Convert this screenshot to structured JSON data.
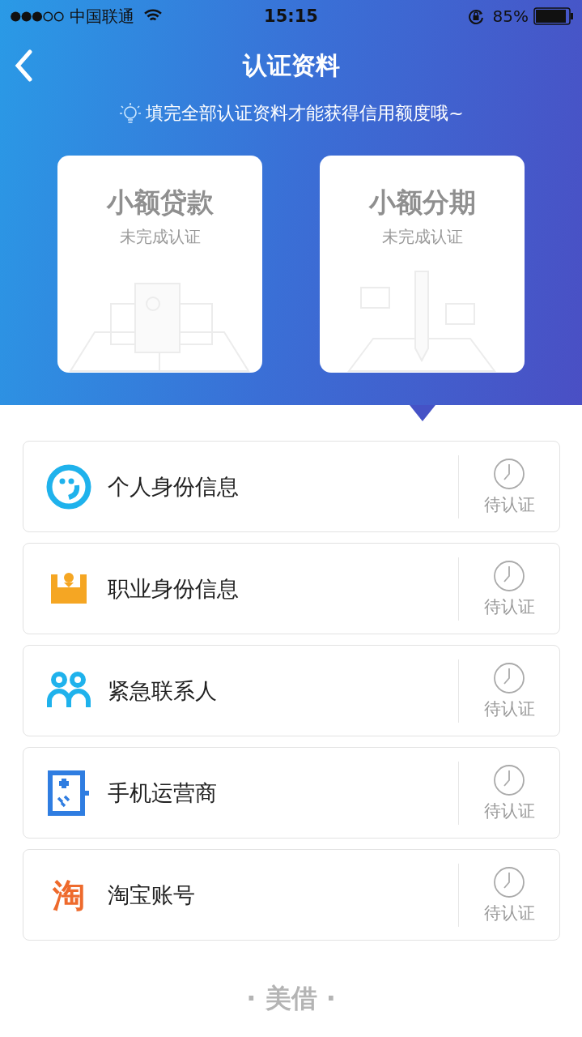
{
  "status_bar": {
    "carrier": "中国联通",
    "time": "15:15",
    "battery": "85%"
  },
  "nav": {
    "title": "认证资料"
  },
  "tip": "填完全部认证资料才能获得信用额度哦~",
  "products": [
    {
      "title": "小额贷款",
      "subtitle": "未完成认证",
      "kind": "documents",
      "selected": false
    },
    {
      "title": "小额分期",
      "subtitle": "未完成认证",
      "kind": "pencil",
      "selected": true
    }
  ],
  "items": [
    {
      "label": "个人身份信息",
      "kind": "face",
      "status": "待认证"
    },
    {
      "label": "职业身份信息",
      "kind": "crown",
      "status": "待认证"
    },
    {
      "label": "紧急联系人",
      "kind": "contacts",
      "status": "待认证"
    },
    {
      "label": "手机运营商",
      "kind": "phone",
      "status": "待认证"
    },
    {
      "label": "淘宝账号",
      "kind": "shop",
      "logo_text": "淘",
      "status": "待认证"
    }
  ],
  "footer": "· 美借 ·"
}
